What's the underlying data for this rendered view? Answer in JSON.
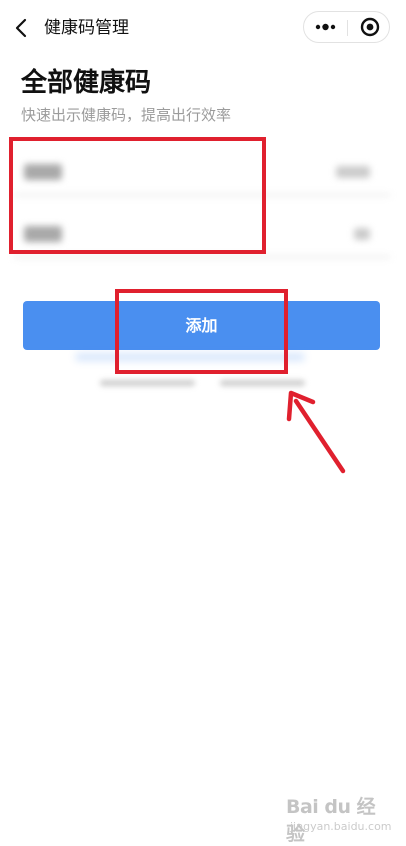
{
  "navbar": {
    "title": "健康码管理",
    "icons": {
      "back": "back-chevron-icon",
      "more": "more-dots-icon",
      "close": "close-target-icon"
    }
  },
  "header": {
    "title": "全部健康码",
    "subtitle": "快速出示健康码，提高出行效率"
  },
  "code_list": {
    "blurred": true,
    "item_count": 2
  },
  "actions": {
    "add_label": "添加"
  },
  "annotations": {
    "color": "#e0202e"
  },
  "watermark": {
    "logo": "Bai du 经验",
    "url": "jingyan.baidu.com"
  },
  "colors": {
    "primary": "#4a8ff0",
    "subtitle": "#9b9b9b",
    "annotation": "#e0202e"
  }
}
